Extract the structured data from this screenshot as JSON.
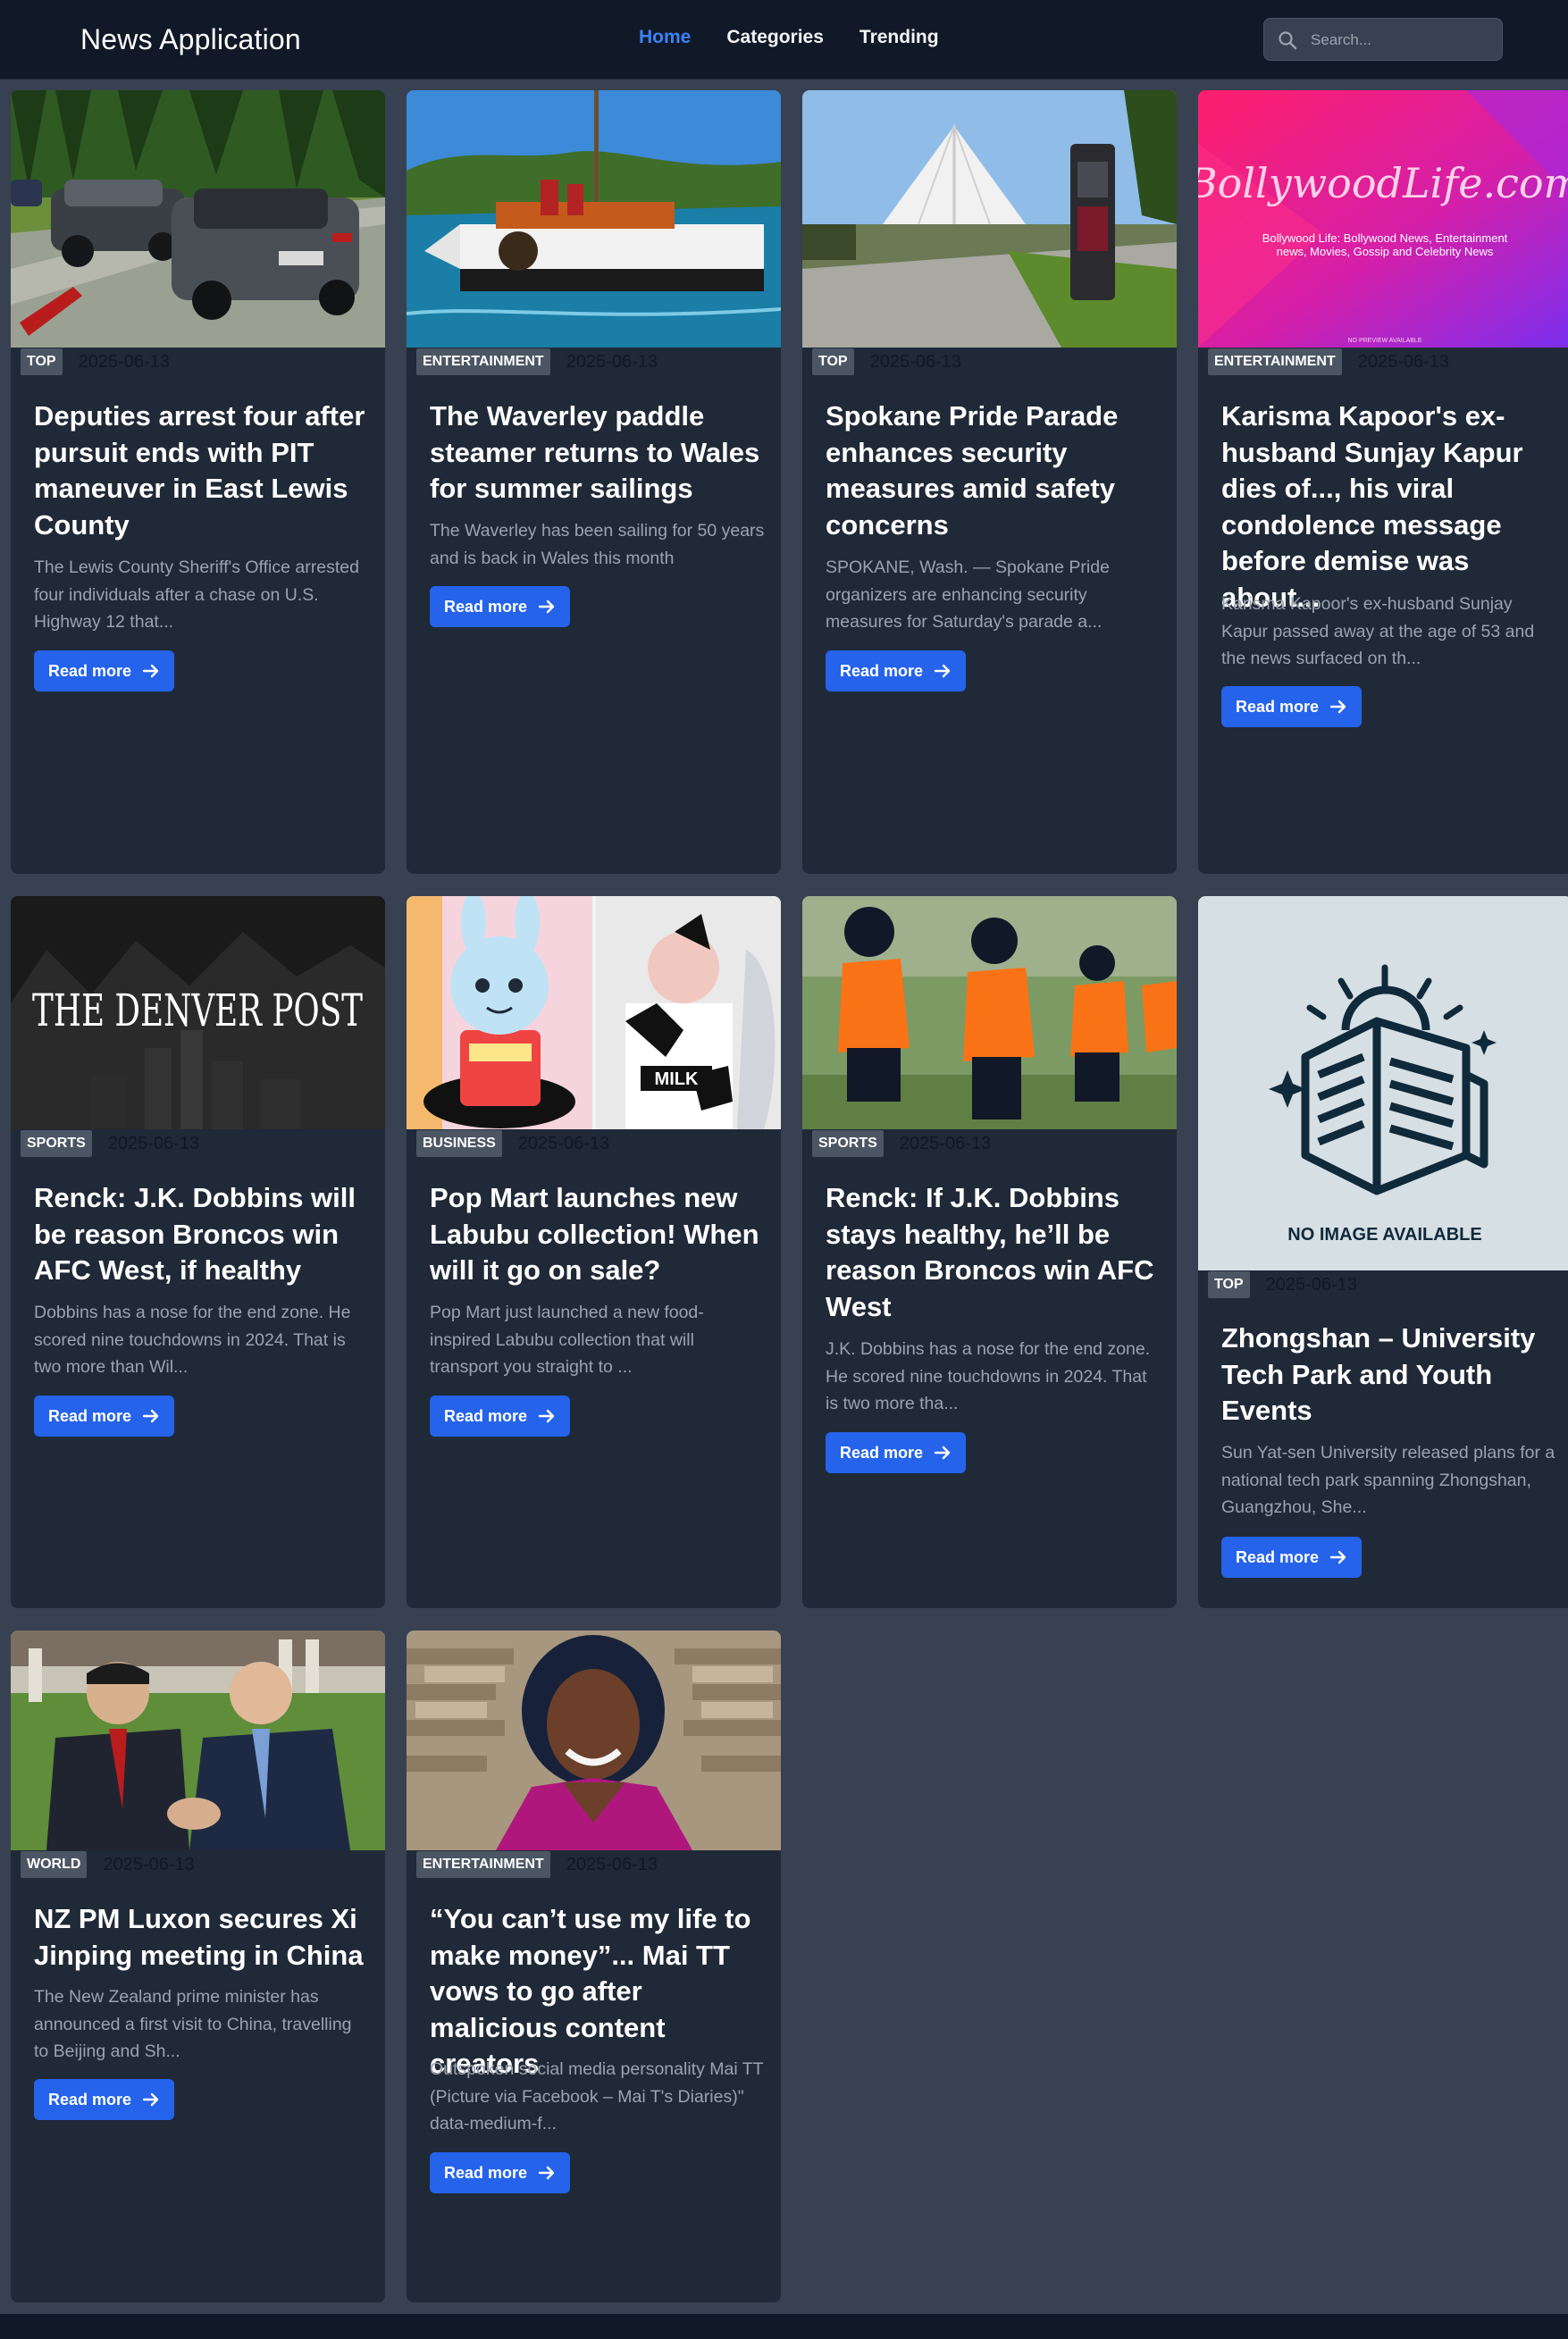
{
  "header": {
    "brand": "News Application",
    "nav": [
      "Home",
      "Categories",
      "Trending"
    ],
    "active_nav": "Home",
    "search_placeholder": "Search..."
  },
  "read_more_label": "Read more",
  "articles": [
    {
      "category": "TOP",
      "date": "2025-06-13",
      "title": "Deputies arrest four after pursuit ends with PIT maneuver in East Lewis County",
      "excerpt": "The Lewis County Sheriff's Office arrested four individuals after a chase on U.S. Highway 12 that...",
      "image": "suvs-roadside-photo"
    },
    {
      "category": "ENTERTAINMENT",
      "date": "2025-06-13",
      "title": "The Waverley paddle steamer returns to Wales for summer sailings",
      "excerpt": "The Waverley has been sailing for 50 years and is back in Wales this month",
      "image": "paddle-steamer-photo"
    },
    {
      "category": "TOP",
      "date": "2025-06-13",
      "title": "Spokane Pride Parade enhances security measures amid safety concerns",
      "excerpt": "SPOKANE, Wash. — Spokane Pride organizers are enhancing security measures for Saturday's parade a...",
      "image": "park-pavilion-photo"
    },
    {
      "category": "ENTERTAINMENT",
      "date": "2025-06-13",
      "title": "Karisma Kapoor's ex-husband Sunjay Kapur dies of..., his viral condolence message before demise was about...",
      "excerpt": "Karisma Kapoor's ex-husband Sunjay Kapur passed away at the age of 53 and the news surfaced on th...",
      "image": "bollywoodlife-banner",
      "image_text": {
        "logo": "BollywoodLife.com",
        "line1": "Bollywood Life: Bollywood News, Entertainment",
        "line2": "news, Movies, Gossip and Celebrity News",
        "foot": "NO PREVIEW AVAILABLE"
      }
    },
    {
      "category": "SPORTS",
      "date": "2025-06-13",
      "title": "Renck: J.K. Dobbins will be reason Broncos win AFC West, if healthy",
      "excerpt": "Dobbins has a nose for the end zone. He scored nine touchdowns in 2024. That is two more than Wil...",
      "image": "denver-post-banner",
      "image_text": {
        "logo": "THE DENVER POST"
      }
    },
    {
      "category": "BUSINESS",
      "date": "2025-06-13",
      "title": "Pop Mart launches new Labubu collection! When will it go on sale?",
      "excerpt": "Pop Mart just launched a new food-inspired Labubu collection that will transport you straight to ...",
      "image": "labubu-toys-photo"
    },
    {
      "category": "SPORTS",
      "date": "2025-06-13",
      "title": "Renck: If J.K. Dobbins stays healthy, he’ll be reason Broncos win AFC West",
      "excerpt": "J.K. Dobbins has a nose for the end zone. He scored nine touchdowns in 2024. That is two more tha...",
      "image": "football-practice-photo"
    },
    {
      "category": "TOP",
      "date": "2025-06-13",
      "title": "Zhongshan – University Tech Park and Youth Events",
      "excerpt": "Sun Yat-sen University released plans for a national tech park spanning Zhongshan, Guangzhou, She...",
      "image": "no-image-placeholder",
      "image_text": {
        "caption": "NO IMAGE AVAILABLE"
      }
    },
    {
      "category": "WORLD",
      "date": "2025-06-13",
      "title": "NZ PM Luxon secures Xi Jinping meeting in China",
      "excerpt": "The New Zealand prime minister has announced a first visit to China, travelling to Beijing and Sh...",
      "image": "leaders-handshake-photo"
    },
    {
      "category": "ENTERTAINMENT",
      "date": "2025-06-13",
      "title": "“You can’t use my life to make money”... Mai TT vows to go after malicious content creators",
      "excerpt": "Outspoken social media personality Mai TT (Picture via Facebook – Mai T's Diaries)\" data-medium-f...",
      "image": "woman-portrait-photo"
    }
  ]
}
